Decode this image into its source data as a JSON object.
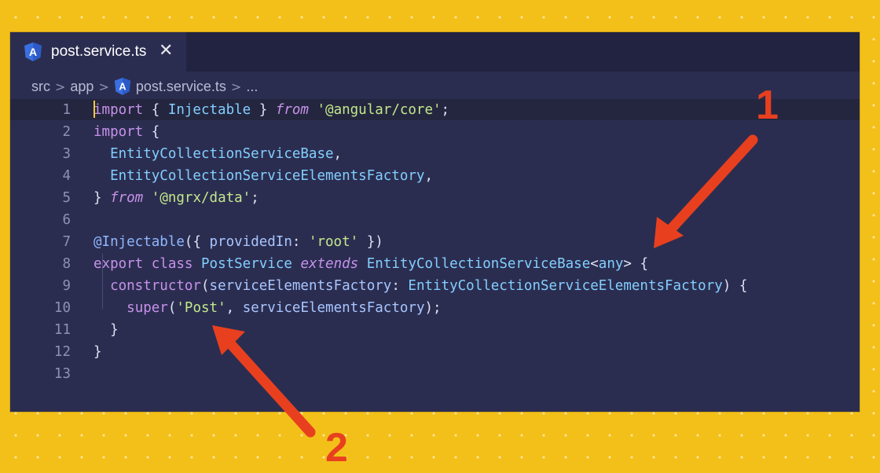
{
  "tab": {
    "file_label": "post.service.ts",
    "close_glyph": "✕",
    "icon": "angular-icon"
  },
  "breadcrumb": {
    "items": [
      "src",
      "app",
      "post.service.ts",
      "..."
    ],
    "separator": ">"
  },
  "editor": {
    "line_numbers": [
      "1",
      "2",
      "3",
      "4",
      "5",
      "6",
      "7",
      "8",
      "9",
      "10",
      "11",
      "12",
      "13"
    ],
    "lines": [
      [
        {
          "t": "import",
          "c": "kw"
        },
        {
          "t": " { ",
          "c": "pn"
        },
        {
          "t": "Injectable",
          "c": "cls"
        },
        {
          "t": " } ",
          "c": "pn"
        },
        {
          "t": "from",
          "c": "kwi"
        },
        {
          "t": " ",
          "c": "pn"
        },
        {
          "t": "'@angular/core'",
          "c": "str"
        },
        {
          "t": ";",
          "c": "pn"
        }
      ],
      [
        {
          "t": "import",
          "c": "kw"
        },
        {
          "t": " {",
          "c": "pn"
        }
      ],
      [
        {
          "t": "  EntityCollectionServiceBase",
          "c": "cls"
        },
        {
          "t": ",",
          "c": "pn"
        }
      ],
      [
        {
          "t": "  EntityCollectionServiceElementsFactory",
          "c": "cls"
        },
        {
          "t": ",",
          "c": "pn"
        }
      ],
      [
        {
          "t": "} ",
          "c": "pn"
        },
        {
          "t": "from",
          "c": "kwi"
        },
        {
          "t": " ",
          "c": "pn"
        },
        {
          "t": "'@ngrx/data'",
          "c": "str"
        },
        {
          "t": ";",
          "c": "pn"
        }
      ],
      [],
      [
        {
          "t": "@Injectable",
          "c": "dec"
        },
        {
          "t": "({ ",
          "c": "pn"
        },
        {
          "t": "providedIn",
          "c": "prop"
        },
        {
          "t": ": ",
          "c": "pn"
        },
        {
          "t": "'root'",
          "c": "str"
        },
        {
          "t": " })",
          "c": "pn"
        }
      ],
      [
        {
          "t": "export",
          "c": "kw"
        },
        {
          "t": " ",
          "c": "pn"
        },
        {
          "t": "class",
          "c": "kw"
        },
        {
          "t": " ",
          "c": "pn"
        },
        {
          "t": "PostService",
          "c": "cls"
        },
        {
          "t": " ",
          "c": "pn"
        },
        {
          "t": "extends",
          "c": "kwi"
        },
        {
          "t": " ",
          "c": "pn"
        },
        {
          "t": "EntityCollectionServiceBase",
          "c": "cls"
        },
        {
          "t": "<",
          "c": "pn"
        },
        {
          "t": "any",
          "c": "cls"
        },
        {
          "t": "> {",
          "c": "pn"
        }
      ],
      [
        {
          "t": "  ",
          "c": "pn"
        },
        {
          "t": "constructor",
          "c": "kw"
        },
        {
          "t": "(",
          "c": "pn"
        },
        {
          "t": "serviceElementsFactory",
          "c": "param"
        },
        {
          "t": ": ",
          "c": "pn"
        },
        {
          "t": "EntityCollectionServiceElementsFactory",
          "c": "cls"
        },
        {
          "t": ") {",
          "c": "pn"
        }
      ],
      [
        {
          "t": "    ",
          "c": "pn"
        },
        {
          "t": "super",
          "c": "fn"
        },
        {
          "t": "(",
          "c": "pn"
        },
        {
          "t": "'Post'",
          "c": "str"
        },
        {
          "t": ", ",
          "c": "pn"
        },
        {
          "t": "serviceElementsFactory",
          "c": "param"
        },
        {
          "t": ");",
          "c": "pn"
        }
      ],
      [
        {
          "t": "  }",
          "c": "pn"
        }
      ],
      [
        {
          "t": "}",
          "c": "pn"
        }
      ],
      []
    ]
  },
  "annotations": {
    "label_1": "1",
    "label_2": "2",
    "arrow_color": "#e8401f"
  },
  "colors": {
    "background": "#f3c019",
    "editor_bg": "#2b2d50",
    "tabbar_bg": "#212341"
  }
}
